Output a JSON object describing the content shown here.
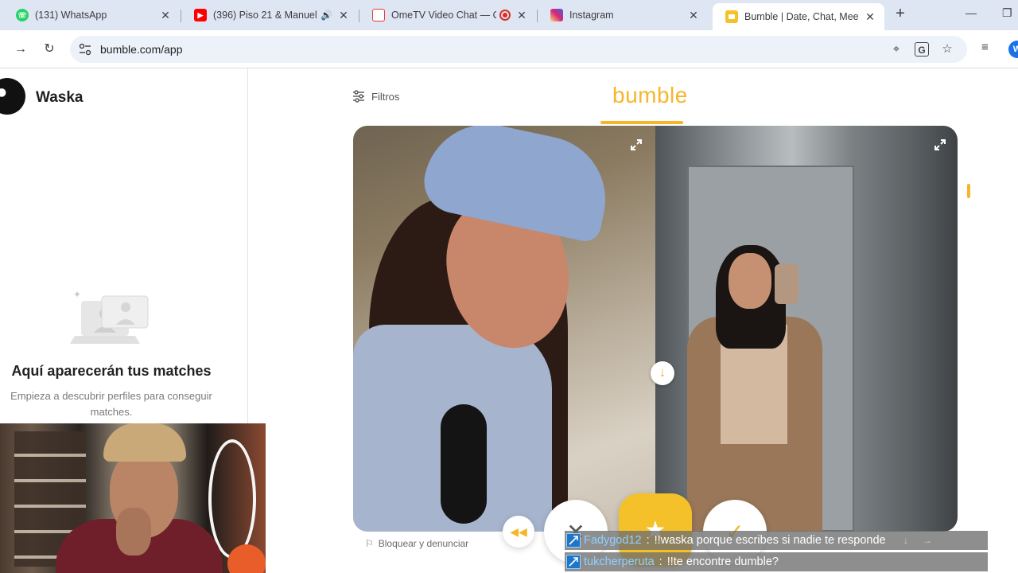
{
  "browser": {
    "tabs": [
      {
        "title": "(131) WhatsApp",
        "icon": "whatsapp-icon",
        "color": "#25d366"
      },
      {
        "title": "(396) Piso 21 & Manuel",
        "icon": "youtube-icon",
        "color": "#ff0000"
      },
      {
        "title": "OmeTV Video Chat — O",
        "icon": "ometv-icon",
        "color": "#e53935"
      },
      {
        "title": "Instagram",
        "icon": "instagram-icon",
        "color": "#d62976"
      },
      {
        "title": "Bumble | Date, Chat, Meet N",
        "icon": "bumble-icon",
        "color": "#f5c12a",
        "active": true
      }
    ],
    "url": "bumble.com/app",
    "profile_initial": "W"
  },
  "sidebar": {
    "user_name": "Waska",
    "empty_title": "Aquí aparecerán tus matches",
    "empty_subtitle": "Empieza a descubrir perfiles para conseguir matches."
  },
  "main": {
    "filters_label": "Filtros",
    "logo_text": "bumble",
    "report_label": "Bloquear y denunciar",
    "accent_color": "#f5b62a"
  },
  "chat_overlay": [
    {
      "user": "Fadygod12",
      "message": "!!waska porque escribes si nadie te responde"
    },
    {
      "user": "tukcherperuta",
      "message": "!!te encontre dumble?"
    }
  ]
}
